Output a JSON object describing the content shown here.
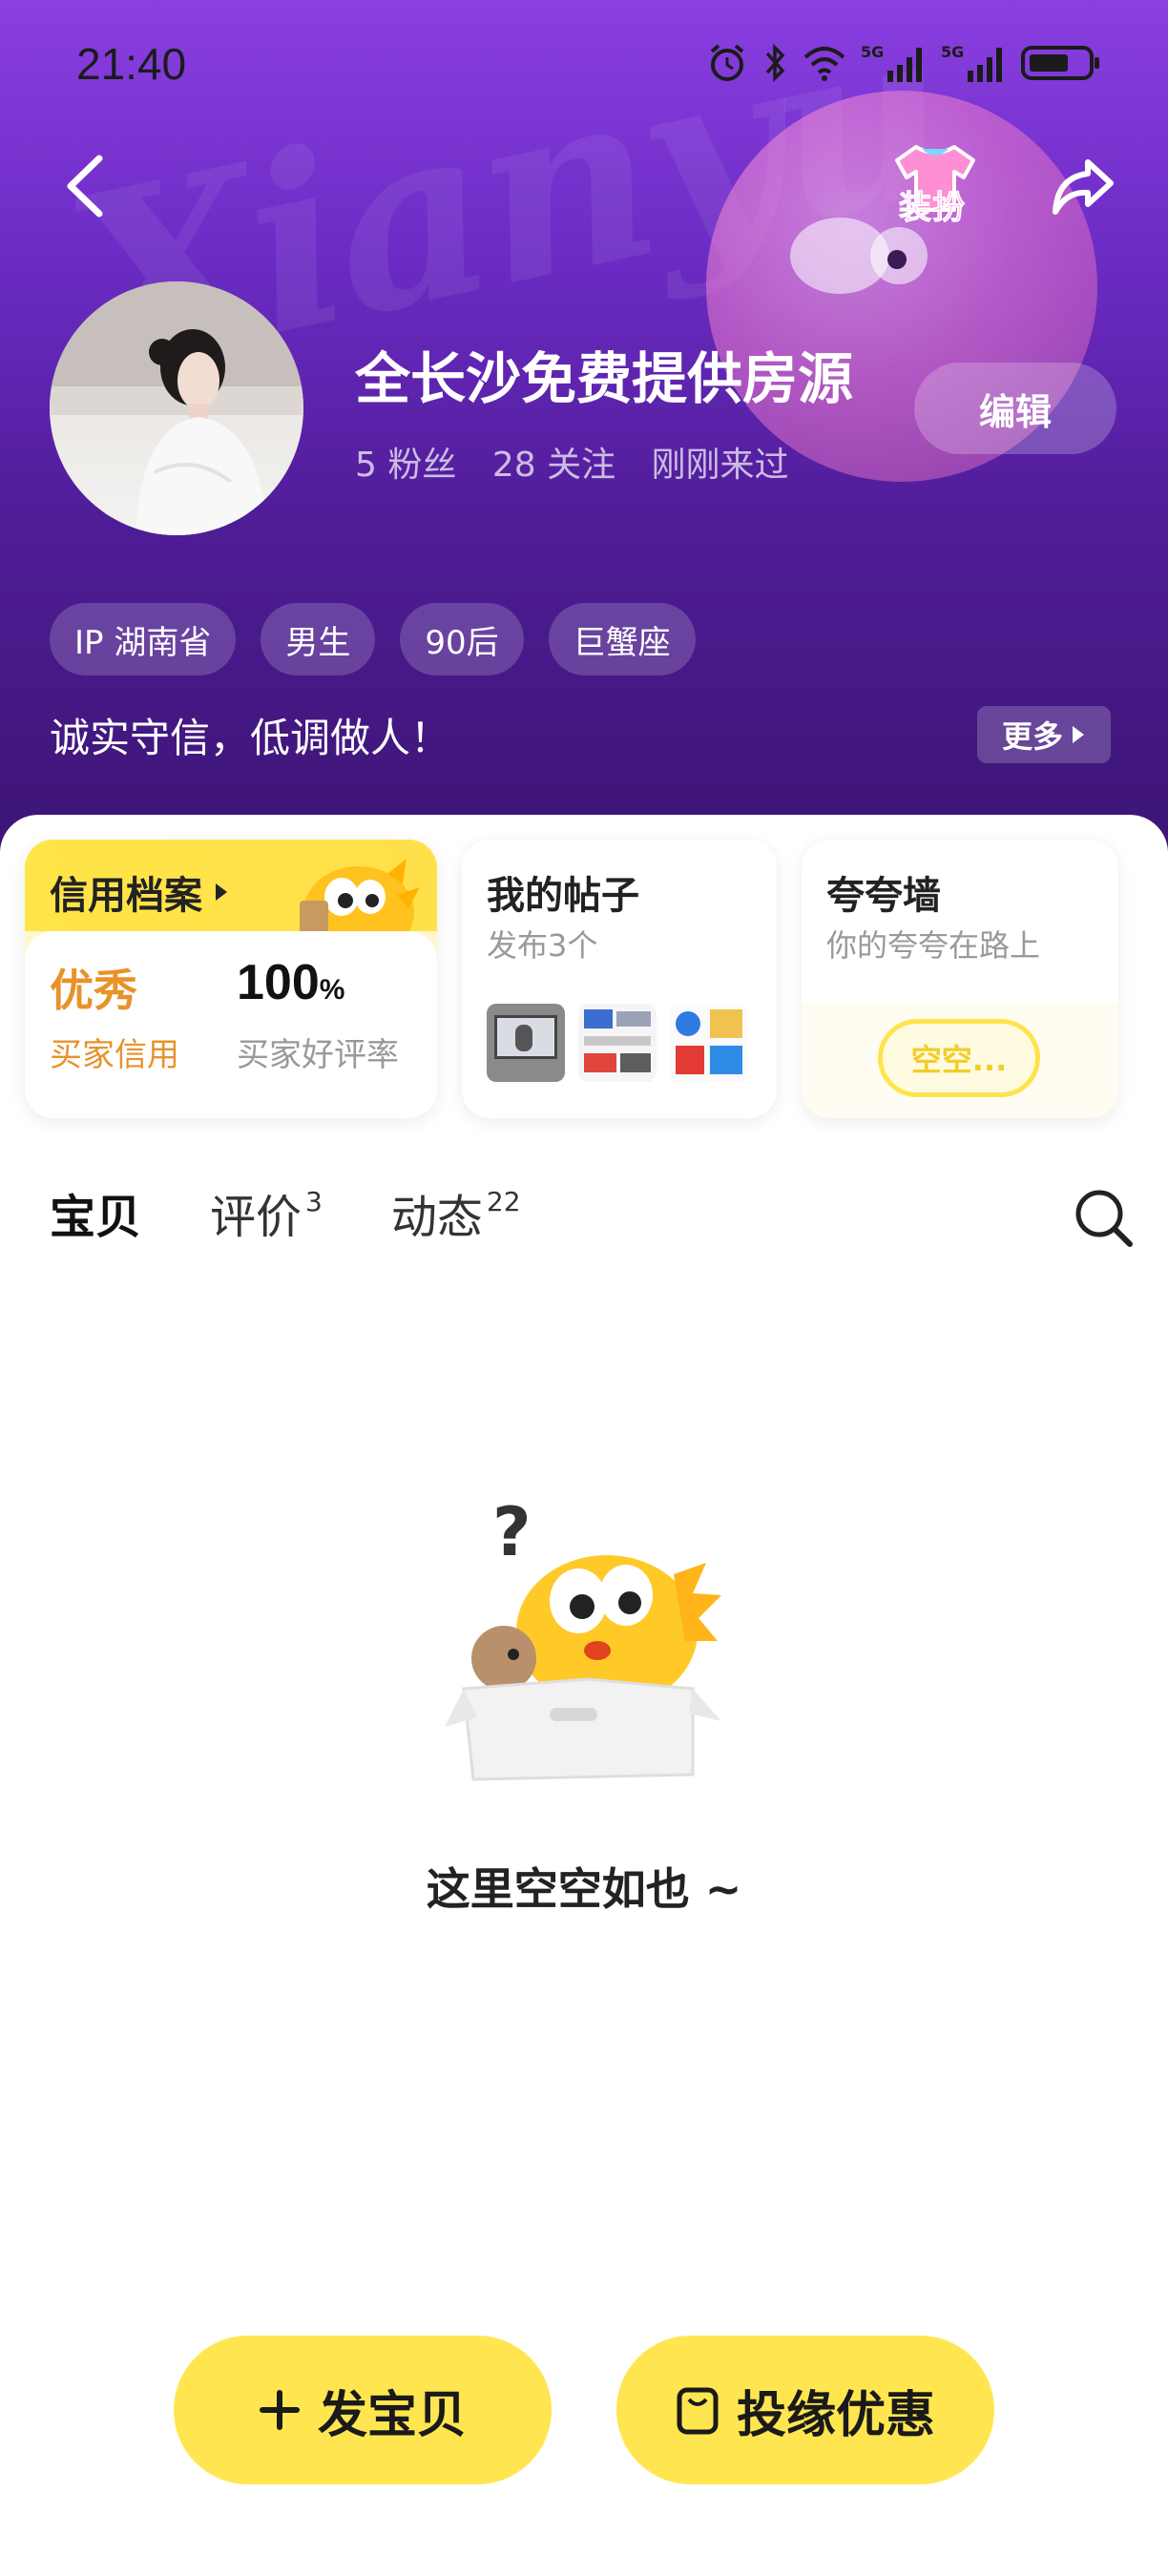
{
  "status_bar": {
    "time": "21:40"
  },
  "header": {
    "watermark": "Xianyu",
    "dress_up_label": "装扮",
    "username": "全长沙免费提供房源",
    "stats": {
      "fans": "5 粉丝",
      "following": "28 关注",
      "last_seen": "刚刚来过"
    },
    "edit_label": "编辑",
    "tags": [
      "IP 湖南省",
      "男生",
      "90后",
      "巨蟹座"
    ],
    "bio": "诚实守信，低调做人！",
    "more_label": "更多"
  },
  "cards": {
    "credit": {
      "title": "信用档案",
      "grade": "优秀",
      "grade_label": "买家信用",
      "rate": "100",
      "rate_unit": "%",
      "rate_label": "买家好评率"
    },
    "posts": {
      "title": "我的帖子",
      "subtitle": "发布3个"
    },
    "praise": {
      "title": "夸夸墙",
      "subtitle": "你的夸夸在路上",
      "bubble": "空空..."
    }
  },
  "tabs": [
    {
      "label": "宝贝",
      "count": ""
    },
    {
      "label": "评价",
      "count": "3"
    },
    {
      "label": "动态",
      "count": "22"
    }
  ],
  "empty_state": {
    "text": "这里空空如也 ~"
  },
  "actions": {
    "post_label": "发宝贝",
    "coupon_label": "投缘优惠"
  },
  "colors": {
    "brand_yellow": "#ffe650",
    "header_purple": "#5a21a8",
    "credit_orange": "#e8922a"
  }
}
